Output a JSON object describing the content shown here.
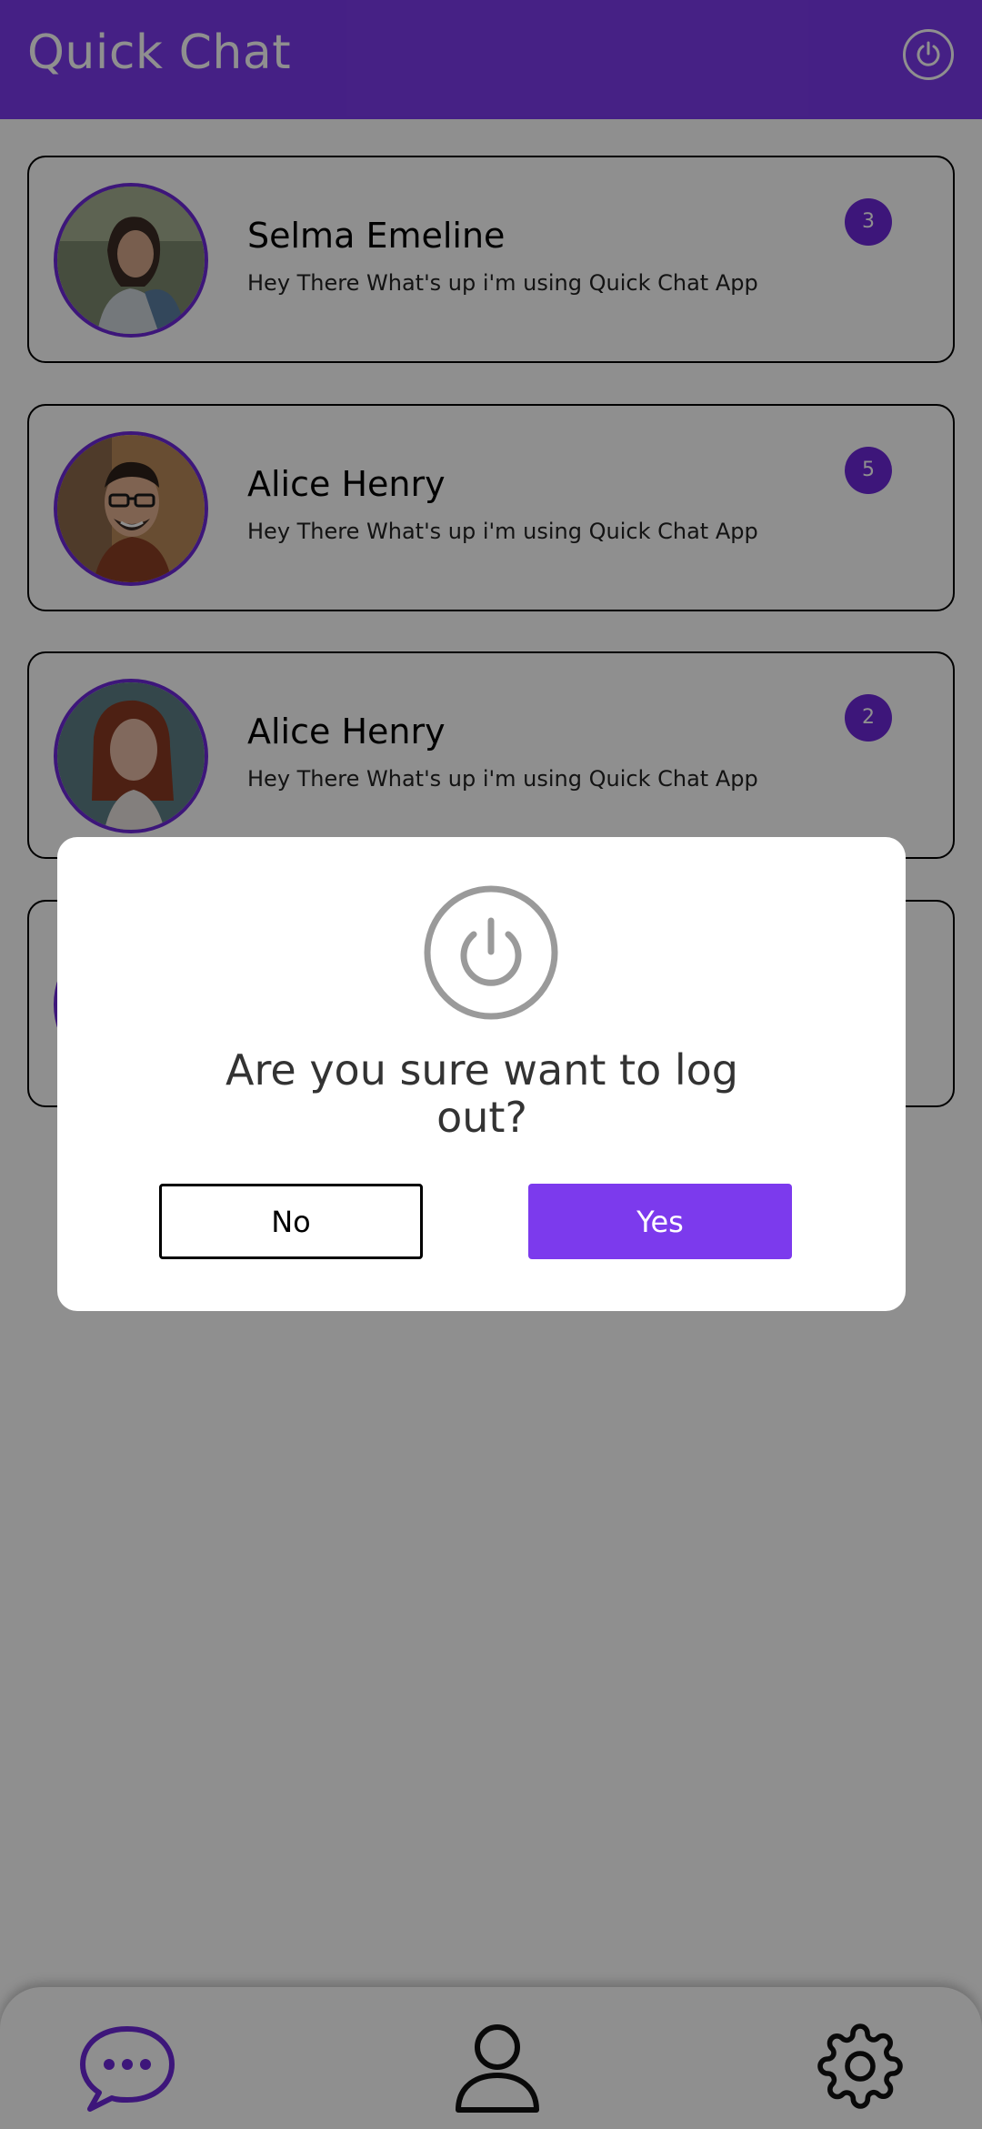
{
  "header": {
    "title": "Quick Chat",
    "power_icon": "power-icon"
  },
  "chats": [
    {
      "name": "Selma Emeline",
      "status": "Hey There What's up i'm using Quick Chat App",
      "unread": "3"
    },
    {
      "name": "Alice Henry",
      "status": "Hey There What's up i'm using Quick Chat App",
      "unread": "5"
    },
    {
      "name": "Alice Henry",
      "status": "Hey There What's up i'm using Quick Chat App",
      "unread": "2"
    }
  ],
  "dialog": {
    "message": "Are you sure want to log out?",
    "no_label": "No",
    "yes_label": "Yes",
    "icon": "power-icon"
  },
  "bottom_nav": {
    "items": [
      "chat-bubble-icon",
      "user-icon",
      "gear-icon"
    ]
  },
  "colors": {
    "accent": "#7c3aed",
    "accent_dark": "#6d28d9",
    "overlay": "rgba(0,0,0,0.44)"
  }
}
